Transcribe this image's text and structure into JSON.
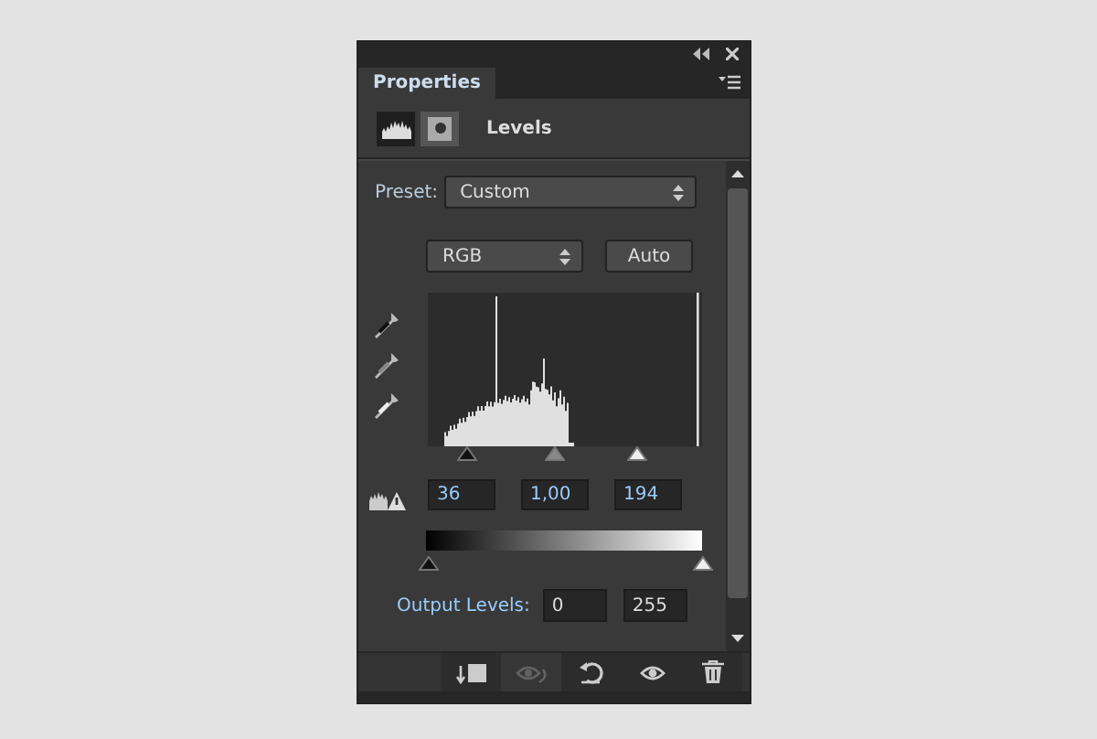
{
  "panel": {
    "tabs": [
      {
        "label": "Properties",
        "selected": true
      }
    ],
    "adjustment_title": "Levels",
    "mode_buttons": [
      {
        "kind": "levels",
        "selected": true
      },
      {
        "kind": "mask",
        "selected": false
      }
    ],
    "preset": {
      "label": "Preset:",
      "value": "Custom"
    },
    "channel": "RGB",
    "auto_button": "Auto",
    "input_levels": {
      "sliders": [
        {
          "kind": "black",
          "level": 0.14
        },
        {
          "kind": "gray",
          "level": 0.46
        },
        {
          "kind": "white",
          "level": 0.76
        }
      ],
      "fields": [
        "36",
        "1,00",
        "194"
      ]
    },
    "output_levels": {
      "label": "Output Levels:",
      "sliders": [
        {
          "kind": "black",
          "level": 0
        },
        {
          "kind": "white",
          "level": 1
        }
      ],
      "fields": [
        "0",
        "255"
      ]
    },
    "footer_buttons": [
      {
        "kind": "clip",
        "disabled": false
      },
      {
        "kind": "previous",
        "disabled": true
      },
      {
        "kind": "reset",
        "disabled": false
      },
      {
        "kind": "visibility",
        "disabled": false
      },
      {
        "kind": "delete",
        "disabled": false
      }
    ]
  }
}
